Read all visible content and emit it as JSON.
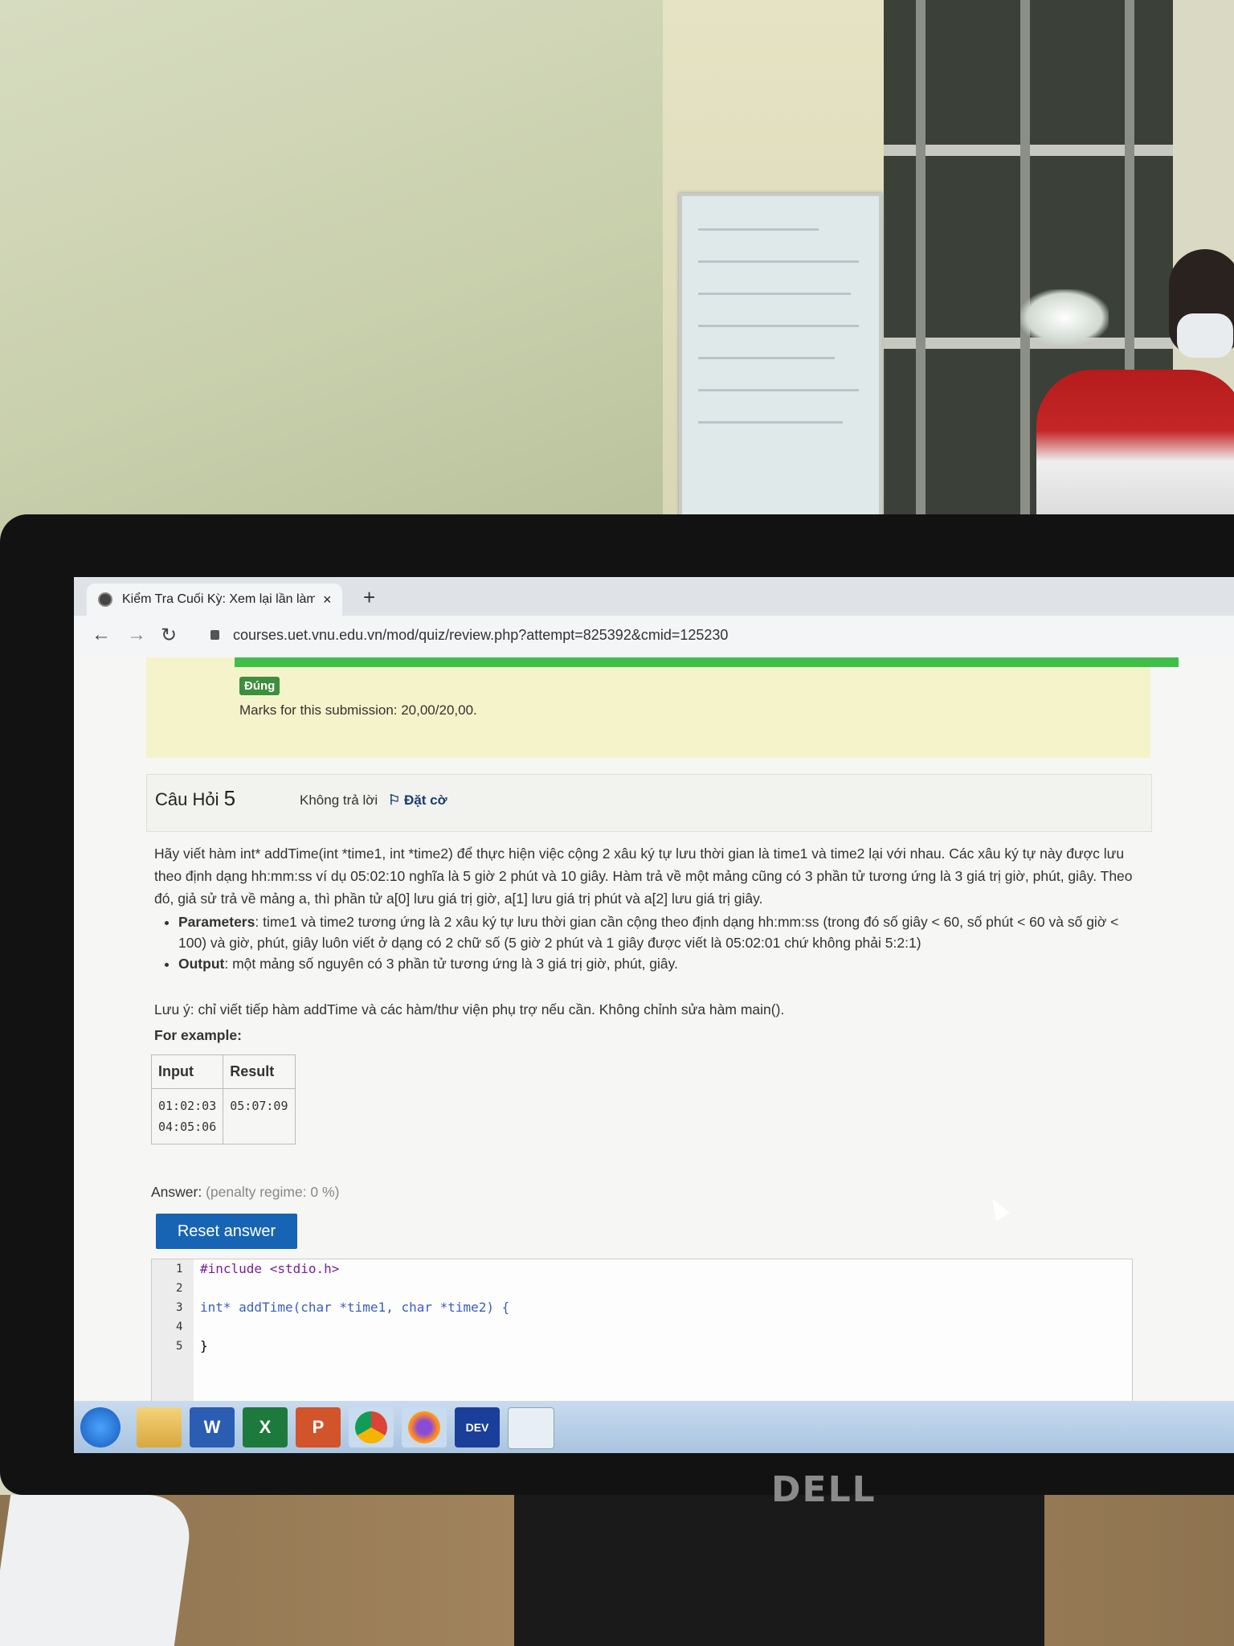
{
  "browser": {
    "tab_title": "Kiểm Tra Cuối Kỳ: Xem lại lần làm",
    "tab_close": "×",
    "new_tab": "+",
    "back": "←",
    "forward": "→",
    "reload": "↻",
    "url": "courses.uet.vnu.edu.vn/mod/quiz/review.php?attempt=825392&cmid=125230"
  },
  "feedback": {
    "badge": "Đúng",
    "marks": "Marks for this submission: 20,00/20,00."
  },
  "question": {
    "label": "Câu Hỏi",
    "number": "5",
    "state": "Không trả lời",
    "flag": "Đặt cờ",
    "flag_icon": "⚐",
    "text": "Hãy viết hàm int* addTime(int *time1, int *time2) để thực hiện việc cộng 2 xâu ký tự lưu thời gian là time1 và time2 lại với nhau. Các xâu ký tự này được lưu theo định dạng hh:mm:ss ví dụ 05:02:10 nghĩa là 5 giờ 2 phút và 10 giây. Hàm trả về một mảng cũng có 3 phần tử tương ứng là 3 giá trị giờ, phút, giây. Theo đó, giả sử trả về mảng a, thì phần tử a[0] lưu giá trị giờ, a[1] lưu giá trị phút và a[2] lưu giá trị giây.",
    "bullets": [
      {
        "term": "Parameters",
        "desc": ": time1 và time2 tương ứng là 2 xâu ký tự lưu thời gian cần cộng theo định dạng hh:mm:ss (trong đó số giây < 60, số phút < 60 và số giờ < 100) và giờ, phút, giây luôn viết ở dạng có 2 chữ số (5 giờ 2 phút và 1 giây được viết là 05:02:01 chứ không phải 5:2:1)"
      },
      {
        "term": "Output",
        "desc": ": một mảng số nguyên có 3 phần tử tương ứng là 3 giá trị giờ, phút, giây."
      }
    ],
    "note": "Lưu ý: chỉ viết tiếp hàm addTime và các hàm/thư viện phụ trợ nếu cần. Không chỉnh sửa hàm main().",
    "for_example": "For example:",
    "table": {
      "headers": [
        "Input",
        "Result"
      ],
      "input_lines": [
        "01:02:03",
        "04:05:06"
      ],
      "result": "05:07:09"
    }
  },
  "answer": {
    "label": "Answer:",
    "penalty": "(penalty regime: 0 %)",
    "reset_button": "Reset answer",
    "code_lines": [
      {
        "n": "1",
        "text": "#include <stdio.h>"
      },
      {
        "n": "2",
        "text": ""
      },
      {
        "n": "3",
        "text": "int* addTime(char *time1, char *time2) {"
      },
      {
        "n": "4",
        "text": ""
      },
      {
        "n": "5",
        "text": "}"
      }
    ]
  },
  "taskbar": {
    "items": [
      "start-orb",
      "file-explorer",
      "word",
      "excel",
      "powerpoint",
      "chrome",
      "firefox",
      "dev-cpp",
      "app-window"
    ],
    "labels": {
      "word": "W",
      "excel": "X",
      "powerpoint": "P",
      "devcpp": "DEV"
    }
  },
  "monitor_brand": "DELL"
}
